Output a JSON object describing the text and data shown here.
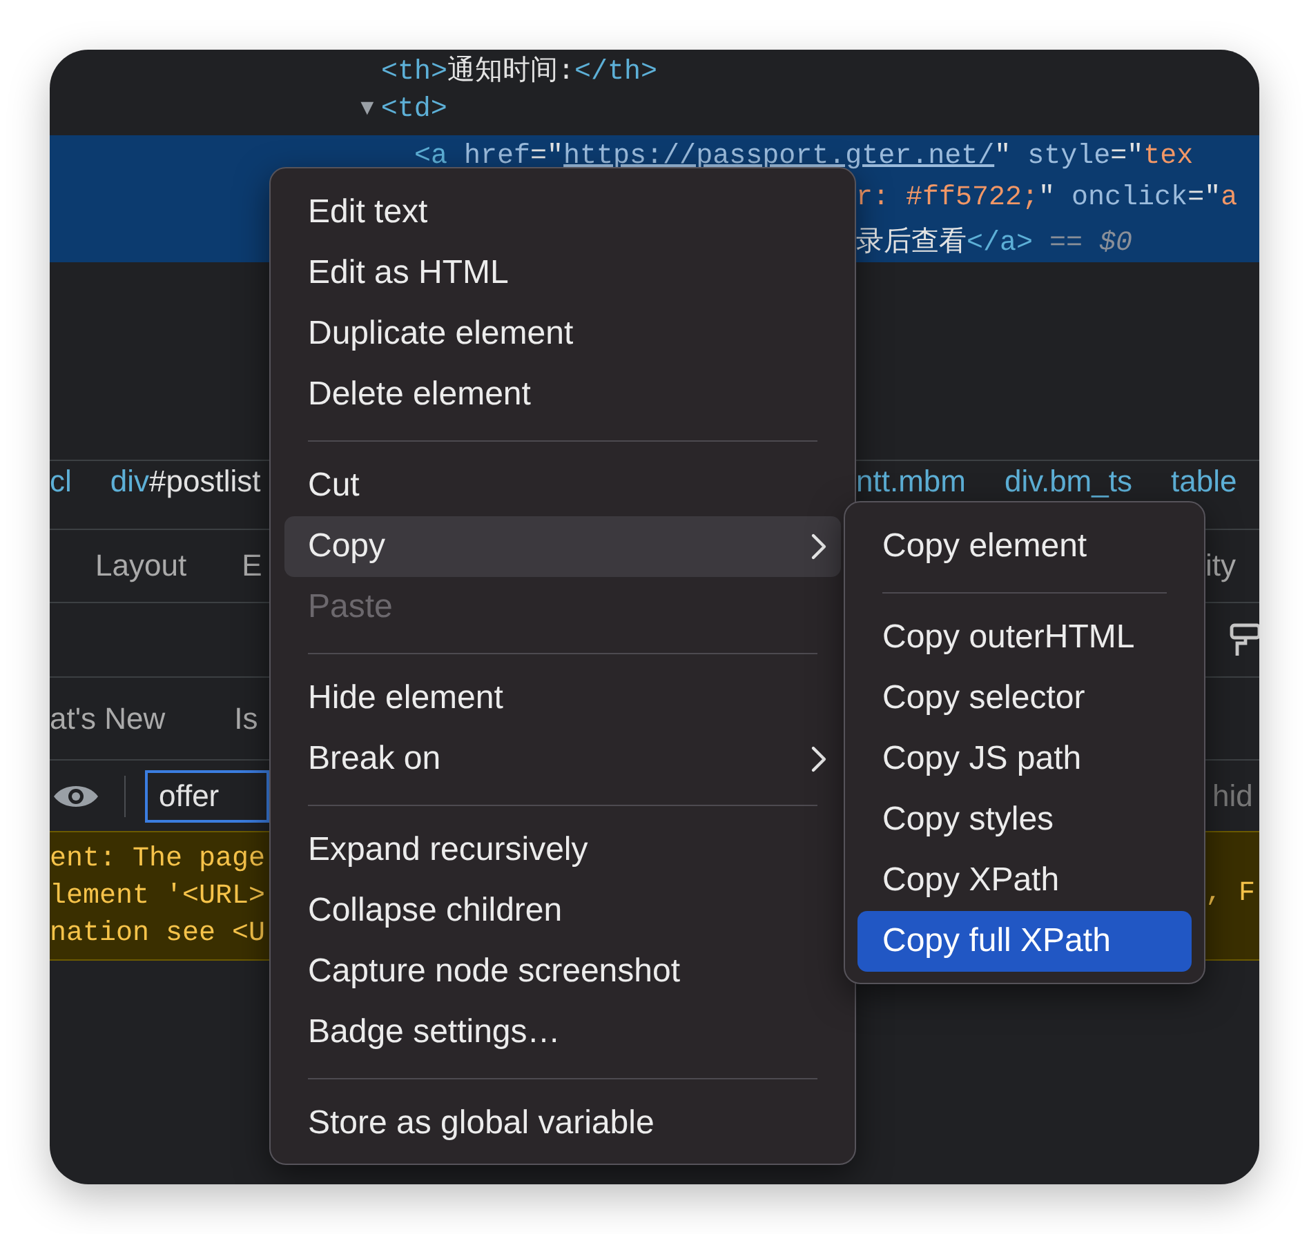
{
  "elements_panel": {
    "lines": [
      {
        "selected": false,
        "parts": [
          {
            "kind": "tag",
            "text": "<th>"
          },
          {
            "kind": "text",
            "text": "通知时间:"
          },
          {
            "kind": "tag",
            "text": "</th>"
          }
        ]
      },
      {
        "selected": false,
        "toggle": "▼",
        "parts": [
          {
            "kind": "tag",
            "text": "<td>"
          }
        ]
      },
      {
        "selected": true,
        "parts": [
          {
            "kind": "tag",
            "text": "<a"
          },
          {
            "kind": "attr",
            "text": " href"
          },
          {
            "kind": "punct",
            "text": "=\""
          },
          {
            "kind": "link",
            "text": "https://passport.gter.net/"
          },
          {
            "kind": "punct",
            "text": "\""
          },
          {
            "kind": "attr",
            "text": " style"
          },
          {
            "kind": "punct",
            "text": "=\""
          },
          {
            "kind": "value",
            "text": "tex"
          }
        ]
      },
      {
        "selected": true,
        "parts": [
          {
            "kind": "value",
            "text": "r: #ff5722;"
          },
          {
            "kind": "punct",
            "text": "\""
          },
          {
            "kind": "attr",
            "text": " onclick"
          },
          {
            "kind": "punct",
            "text": "=\""
          },
          {
            "kind": "value",
            "text": "a"
          }
        ]
      },
      {
        "selected": true,
        "parts": [
          {
            "kind": "text",
            "text": "录后查看"
          },
          {
            "kind": "tag",
            "text": "</a>"
          },
          {
            "kind": "note",
            "text": " == $0"
          }
        ]
      }
    ]
  },
  "breadcrumbs": {
    "left": [
      {
        "tag": "cl"
      },
      {
        "tag": "div",
        "rest": "#postlist"
      }
    ],
    "right": [
      {
        "tag": "ntt.mbm"
      },
      {
        "tag": "div.bm_ts"
      },
      {
        "tag": "table"
      }
    ]
  },
  "sidebar_tabs": {
    "left": [
      "Layout",
      "E"
    ],
    "right": [
      "ity"
    ]
  },
  "drawer_tabs": [
    "at's New",
    "Is"
  ],
  "filter": {
    "value": "offer",
    "hint_text": "hid"
  },
  "console_warning": {
    "left": [
      "ent: The page",
      "lement '<URL>",
      "nation see <U"
    ],
    "right": ", F"
  },
  "context_menu": {
    "items": [
      {
        "kind": "item",
        "label": "Edit text",
        "selected": false,
        "disabled": false,
        "submenu": false
      },
      {
        "kind": "item",
        "label": "Edit as HTML",
        "selected": false,
        "disabled": false,
        "submenu": false
      },
      {
        "kind": "item",
        "label": "Duplicate element",
        "selected": false,
        "disabled": false,
        "submenu": false
      },
      {
        "kind": "item",
        "label": "Delete element",
        "selected": false,
        "disabled": false,
        "submenu": false
      },
      {
        "kind": "separator"
      },
      {
        "kind": "item",
        "label": "Cut",
        "selected": false,
        "disabled": false,
        "submenu": false
      },
      {
        "kind": "item",
        "label": "Copy",
        "selected": true,
        "disabled": false,
        "submenu": true
      },
      {
        "kind": "item",
        "label": "Paste",
        "selected": false,
        "disabled": true,
        "submenu": false
      },
      {
        "kind": "separator"
      },
      {
        "kind": "item",
        "label": "Hide element",
        "selected": false,
        "disabled": false,
        "submenu": false
      },
      {
        "kind": "item",
        "label": "Break on",
        "selected": false,
        "disabled": false,
        "submenu": true
      },
      {
        "kind": "separator"
      },
      {
        "kind": "item",
        "label": "Expand recursively",
        "selected": false,
        "disabled": false,
        "submenu": false
      },
      {
        "kind": "item",
        "label": "Collapse children",
        "selected": false,
        "disabled": false,
        "submenu": false
      },
      {
        "kind": "item",
        "label": "Capture node screenshot",
        "selected": false,
        "disabled": false,
        "submenu": false
      },
      {
        "kind": "item",
        "label": "Badge settings…",
        "selected": false,
        "disabled": false,
        "submenu": false
      },
      {
        "kind": "separator"
      },
      {
        "kind": "item",
        "label": "Store as global variable",
        "selected": false,
        "disabled": false,
        "submenu": false
      }
    ]
  },
  "copy_submenu": {
    "items": [
      {
        "kind": "item",
        "label": "Copy element",
        "selected": false
      },
      {
        "kind": "separator"
      },
      {
        "kind": "item",
        "label": "Copy outerHTML",
        "selected": false
      },
      {
        "kind": "item",
        "label": "Copy selector",
        "selected": false
      },
      {
        "kind": "item",
        "label": "Copy JS path",
        "selected": false
      },
      {
        "kind": "item",
        "label": "Copy styles",
        "selected": false
      },
      {
        "kind": "item",
        "label": "Copy XPath",
        "selected": false
      },
      {
        "kind": "item",
        "label": "Copy full XPath",
        "selected": true
      }
    ]
  }
}
